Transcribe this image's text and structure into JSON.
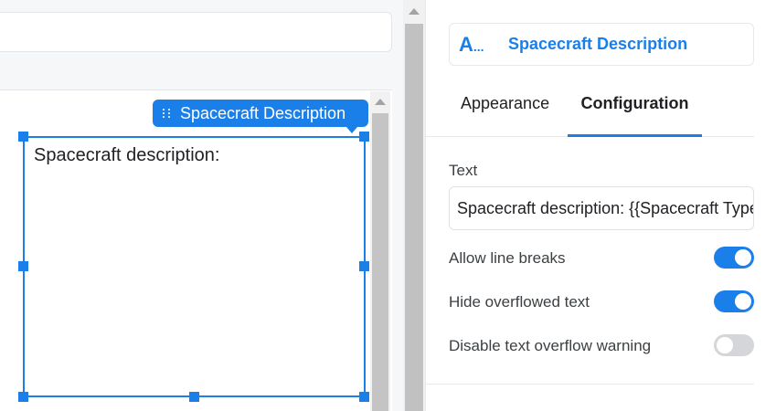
{
  "canvas": {
    "component_tag_label": "Spacecraft Description",
    "text_box_content": "Spacecraft description:"
  },
  "panel": {
    "header": {
      "icon_text": "A",
      "icon_suffix": "...",
      "title": "Spacecraft Description"
    },
    "tabs": [
      {
        "label": "Appearance",
        "active": false
      },
      {
        "label": "Configuration",
        "active": true
      }
    ],
    "text_label": "Text",
    "text_value": "Spacecraft description: {{Spacecraft Type}}",
    "toggles": [
      {
        "label": "Allow line breaks",
        "on": true
      },
      {
        "label": "Hide overflowed text",
        "on": true
      },
      {
        "label": "Disable text overflow warning",
        "on": false
      }
    ]
  },
  "colors": {
    "accent": "#1a7fe8",
    "toggle_off": "#d4d6d9"
  }
}
